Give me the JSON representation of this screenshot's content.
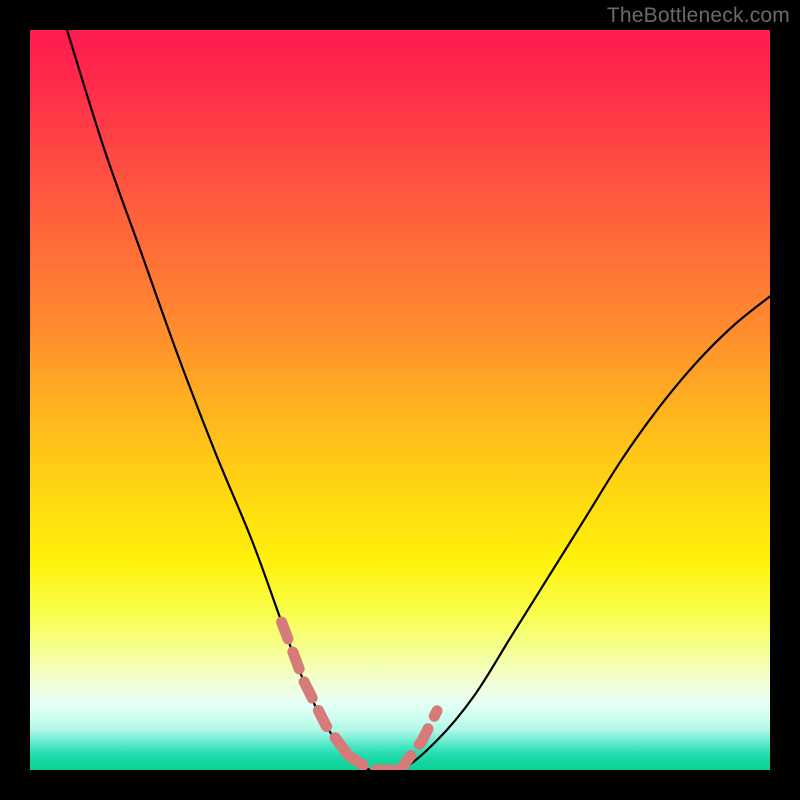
{
  "watermark": "TheBottleneck.com",
  "chart_data": {
    "type": "line",
    "title": "",
    "xlabel": "",
    "ylabel": "",
    "xlim": [
      0,
      100
    ],
    "ylim": [
      0,
      100
    ],
    "grid": false,
    "legend": false,
    "series": [
      {
        "name": "bottleneck-curve",
        "x": [
          5,
          10,
          15,
          20,
          25,
          30,
          34,
          37,
          40,
          43,
          46,
          50,
          55,
          60,
          65,
          70,
          75,
          80,
          85,
          90,
          95,
          100
        ],
        "y": [
          100,
          84,
          70,
          56,
          43,
          31,
          20,
          12,
          6,
          2,
          0,
          0,
          4,
          10,
          18,
          26,
          34,
          42,
          49,
          55,
          60,
          64
        ]
      }
    ],
    "highlight": {
      "name": "optimal-range-dashes",
      "left": {
        "x": [
          34,
          37,
          40,
          43
        ],
        "y": [
          20,
          12,
          6,
          2
        ]
      },
      "floor": {
        "x": [
          43,
          46,
          50
        ],
        "y": [
          2,
          0,
          0
        ]
      },
      "right": {
        "x": [
          50,
          53,
          55
        ],
        "y": [
          0,
          4,
          8
        ]
      }
    },
    "background": {
      "type": "vertical-gradient",
      "stops": [
        {
          "pos": 0.0,
          "color": "#ff1a4f"
        },
        {
          "pos": 0.3,
          "color": "#ff6a39"
        },
        {
          "pos": 0.66,
          "color": "#ffd712"
        },
        {
          "pos": 0.9,
          "color": "#f5ffa6"
        },
        {
          "pos": 1.0,
          "color": "#0fd198"
        }
      ]
    }
  }
}
